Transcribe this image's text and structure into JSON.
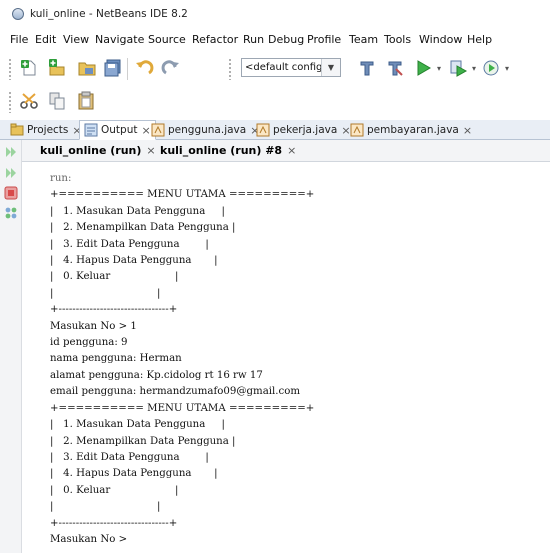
{
  "window": {
    "title": "kuli_online - NetBeans IDE 8.2"
  },
  "menubar": [
    "File",
    "Edit",
    "View",
    "Navigate",
    "Source",
    "Refactor",
    "Run",
    "Debug",
    "Profile",
    "Team",
    "Tools",
    "Window",
    "Help"
  ],
  "toolbar": {
    "config_value": "<default config>",
    "icons": [
      "new-file-icon",
      "new-project-icon",
      "open-project-icon",
      "save-all-icon",
      "undo-icon",
      "redo-icon",
      "config-dropdown-icon",
      "clean-build-icon",
      "run-icon",
      "debug-icon",
      "profile-icon",
      "cut-icon",
      "copy-icon",
      "paste-icon"
    ]
  },
  "tabs": [
    {
      "label": "Projects",
      "close": "×"
    },
    {
      "label": "Output",
      "close": "×"
    },
    {
      "label": "pengguna.java",
      "close": "×"
    },
    {
      "label": "pekerja.java",
      "close": "×"
    },
    {
      "label": "pembayaran.java",
      "close": "×"
    }
  ],
  "subtabs": [
    {
      "label": "kuli_online (run)",
      "close": "×"
    },
    {
      "label": "kuli_online (run) #8",
      "close": "×"
    }
  ],
  "console_lines": [
    "run:",
    "+========== MENU UTAMA =========+",
    "|   1. Masukan Data Pengguna     |",
    "|   2. Menampilkan Data Pengguna |",
    "|   3. Edit Data Pengguna        |",
    "|   4. Hapus Data Pengguna       |",
    "|   0. Keluar                    |",
    "|                                |",
    "+--------------------------------+",
    "Masukan No > 1",
    "id pengguna: 9",
    "nama pengguna: Herman",
    "alamat pengguna: Kp.cidolog rt 16 rw 17",
    "email pengguna: hermandzumafo09@gmail.com",
    "+========== MENU UTAMA =========+",
    "|   1. Masukan Data Pengguna     |",
    "|   2. Menampilkan Data Pengguna |",
    "|   3. Edit Data Pengguna        |",
    "|   4. Hapus Data Pengguna       |",
    "|   0. Keluar                    |",
    "|                                |",
    "+--------------------------------+",
    "Masukan No > "
  ]
}
